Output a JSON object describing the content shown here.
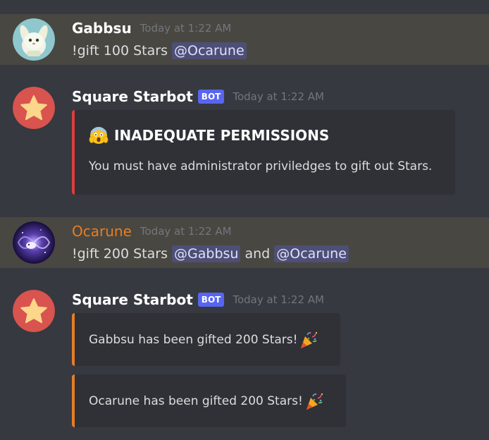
{
  "messages": [
    {
      "username": "Gabbsu",
      "timestamp": "Today at 1:22 AM",
      "text_before": "!gift 100 Stars ",
      "mention1": "@Ocarune"
    },
    {
      "username": "Square Starbot",
      "bot_tag": "BOT",
      "timestamp": "Today at 1:22 AM",
      "embed_title": "INADEQUATE PERMISSIONS",
      "embed_title_icon": "screaming-face-emoji",
      "embed_desc": "You must have administrator priviledges to gift out Stars."
    },
    {
      "username": "Ocarune",
      "timestamp": "Today at 1:22 AM",
      "text_before": "!gift 200 Stars ",
      "mention1": "@Gabbsu",
      "text_middle": " and ",
      "mention2": "@Ocarune"
    },
    {
      "username": "Square Starbot",
      "bot_tag": "BOT",
      "timestamp": "Today at 1:22 AM",
      "embeds": [
        {
          "text": "Gabbsu has been gifted 200 Stars!",
          "icon": "party-popper-emoji"
        },
        {
          "text": "Ocarune has been gifted 200 Stars!",
          "icon": "party-popper-emoji"
        }
      ]
    }
  ],
  "colors": {
    "background": "#36393f",
    "highlight": "#494741",
    "embed_bg": "#2f3136",
    "embed_red": "#e03c3c",
    "embed_orange": "#e67e22",
    "bot_tag": "#5865f2",
    "starbot_avatar": "#d9534f",
    "star": "#fcd68a"
  }
}
